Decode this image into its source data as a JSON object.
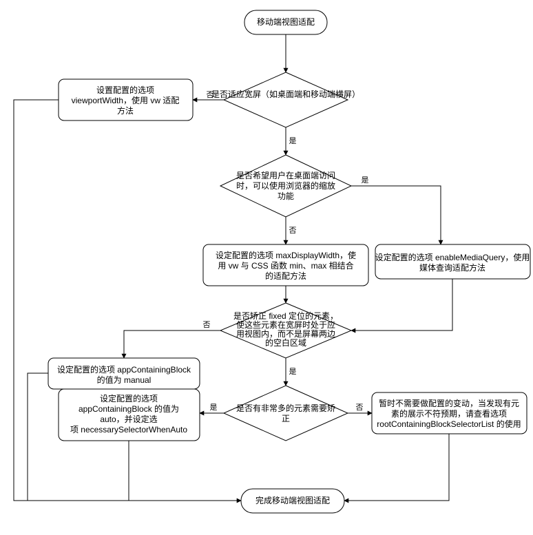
{
  "nodes": {
    "start": "移动端视图适配",
    "d1": "是否适应宽屏（如桌面端和移动端横屏）",
    "p1_l1": "设置配置的选项",
    "p1_l2": "viewportWidth，使用 vw 适配",
    "p1_l3": "方法",
    "d2_l1": "是否希望用户在桌面端访问",
    "d2_l2": "时，可以使用浏览器的缩放",
    "d2_l3": "功能",
    "p2_l1": "设定配置的选项 maxDisplayWidth，使",
    "p2_l2": "用 vw 与 CSS 函数 min、max 相结合",
    "p2_l3": "的适配方法",
    "p3_l1": "设定配置的选项 enableMediaQuery，使用",
    "p3_l2": "媒体查询适配方法",
    "d3_l1": "是否矫正 fixed 定位的元素，",
    "d3_l2": "使这些元素在宽屏时处于应",
    "d3_l3": "用视图内，而不是屏幕两边",
    "d3_l4": "的空白区域",
    "p4_l1": "设定配置的选项 appContainingBlock",
    "p4_l2": "的值为 manual",
    "d4_l1": "是否有非常多的元素需要矫",
    "d4_l2": "正",
    "p5_l1": "设定配置的选项",
    "p5_l2": "appContainingBlock 的值为",
    "p5_l3": "auto，并设定选",
    "p5_l4": "项 necessarySelectorWhenAuto",
    "p6_l1": "暂时不需要做配置的变动，当发现有元",
    "p6_l2": "素的展示不符预期，请查看选项",
    "p6_l3": "rootContainingBlockSelectorList 的使用",
    "end": "完成移动端视图适配"
  },
  "edges": {
    "yes": "是",
    "no": "否"
  },
  "chart_data": {
    "type": "flowchart",
    "title": "移动端视图适配",
    "nodes": [
      {
        "id": "start",
        "type": "terminator",
        "text": "移动端视图适配"
      },
      {
        "id": "d1",
        "type": "decision",
        "text": "是否适应宽屏（如桌面端和移动端横屏）"
      },
      {
        "id": "p1",
        "type": "process",
        "text": "设置配置的选项 viewportWidth，使用 vw 适配方法"
      },
      {
        "id": "d2",
        "type": "decision",
        "text": "是否希望用户在桌面端访问时，可以使用浏览器的缩放功能"
      },
      {
        "id": "p2",
        "type": "process",
        "text": "设定配置的选项 maxDisplayWidth，使用 vw 与 CSS 函数 min、max 相结合的适配方法"
      },
      {
        "id": "p3",
        "type": "process",
        "text": "设定配置的选项 enableMediaQuery，使用媒体查询适配方法"
      },
      {
        "id": "d3",
        "type": "decision",
        "text": "是否矫正 fixed 定位的元素，使这些元素在宽屏时处于应用视图内，而不是屏幕两边的空白区域"
      },
      {
        "id": "p4",
        "type": "process",
        "text": "设定配置的选项 appContainingBlock 的值为 manual"
      },
      {
        "id": "d4",
        "type": "decision",
        "text": "是否有非常多的元素需要矫正"
      },
      {
        "id": "p5",
        "type": "process",
        "text": "设定配置的选项 appContainingBlock 的值为 auto，并设定选项 necessarySelectorWhenAuto"
      },
      {
        "id": "p6",
        "type": "process",
        "text": "暂时不需要做配置的变动，当发现有元素的展示不符预期，请查看选项 rootContainingBlockSelectorList 的使用"
      },
      {
        "id": "end",
        "type": "terminator",
        "text": "完成移动端视图适配"
      }
    ],
    "edges": [
      {
        "from": "start",
        "to": "d1"
      },
      {
        "from": "d1",
        "to": "p1",
        "label": "否"
      },
      {
        "from": "d1",
        "to": "d2",
        "label": "是"
      },
      {
        "from": "d2",
        "to": "p2",
        "label": "否"
      },
      {
        "from": "d2",
        "to": "p3",
        "label": "是"
      },
      {
        "from": "p2",
        "to": "d3"
      },
      {
        "from": "p3",
        "to": "d3"
      },
      {
        "from": "d3",
        "to": "p4",
        "label": "否"
      },
      {
        "from": "d3",
        "to": "d4",
        "label": "是"
      },
      {
        "from": "d4",
        "to": "p5",
        "label": "是"
      },
      {
        "from": "d4",
        "to": "p6",
        "label": "否"
      },
      {
        "from": "p1",
        "to": "end"
      },
      {
        "from": "p4",
        "to": "end"
      },
      {
        "from": "p5",
        "to": "end"
      },
      {
        "from": "p6",
        "to": "end"
      }
    ]
  }
}
